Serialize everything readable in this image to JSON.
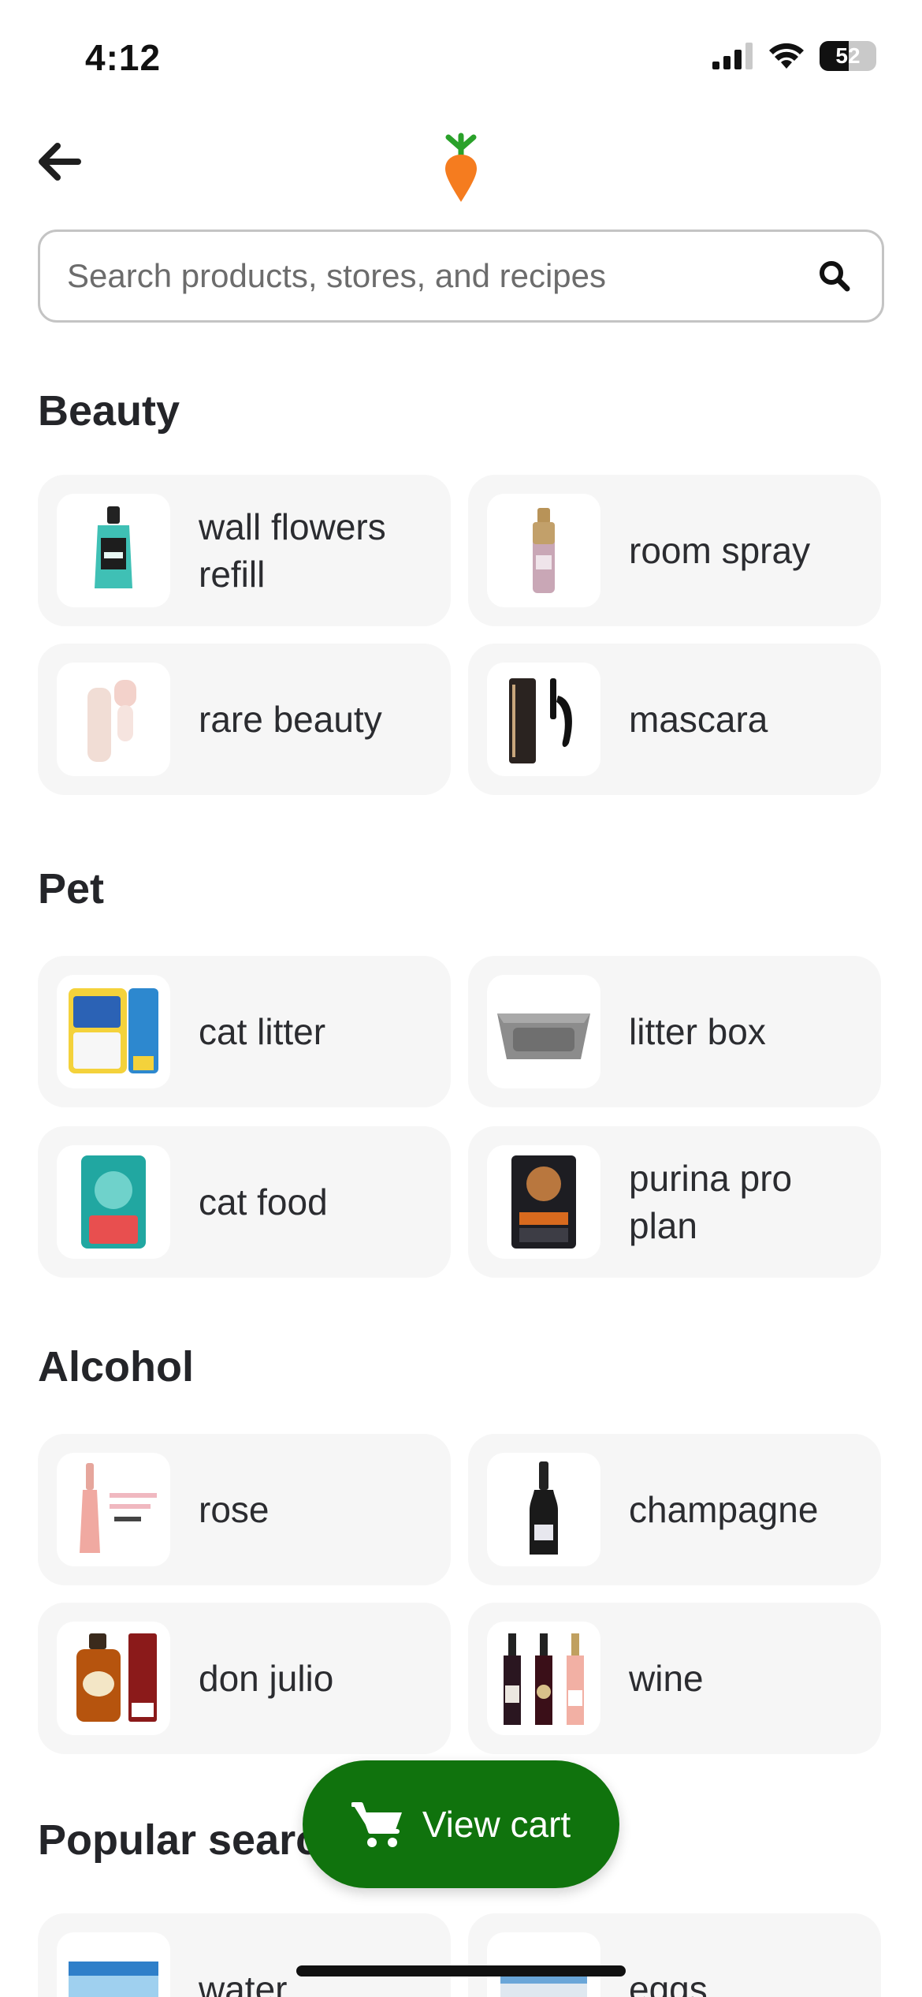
{
  "status_bar": {
    "time": "4:12",
    "battery": "52",
    "battery_level": 0.52
  },
  "header": {
    "back_icon": "arrow-left-icon",
    "logo": "carrot-logo"
  },
  "search": {
    "placeholder": "Search products, stores, and recipes",
    "value": "",
    "icon": "search-icon"
  },
  "sections": [
    {
      "title": "Beauty",
      "items": [
        {
          "label": "wall flowers refill"
        },
        {
          "label": "room spray"
        },
        {
          "label": "rare beauty"
        },
        {
          "label": "mascara"
        }
      ]
    },
    {
      "title": "Pet",
      "items": [
        {
          "label": "cat litter"
        },
        {
          "label": "litter box"
        },
        {
          "label": "cat food"
        },
        {
          "label": "purina pro plan"
        }
      ]
    },
    {
      "title": "Alcohol",
      "items": [
        {
          "label": "rose"
        },
        {
          "label": "champagne"
        },
        {
          "label": "don julio"
        },
        {
          "label": "wine"
        }
      ]
    },
    {
      "title": "Popular searches",
      "items": [
        {
          "label": "water"
        },
        {
          "label": "eggs"
        }
      ]
    }
  ],
  "cart_button": {
    "label": "View cart",
    "icon": "cart-icon"
  },
  "colors": {
    "brand_green": "#10730d",
    "carrot_orange": "#f57c1f",
    "leaf_green": "#2aa12a",
    "card_bg": "#f6f6f6"
  }
}
